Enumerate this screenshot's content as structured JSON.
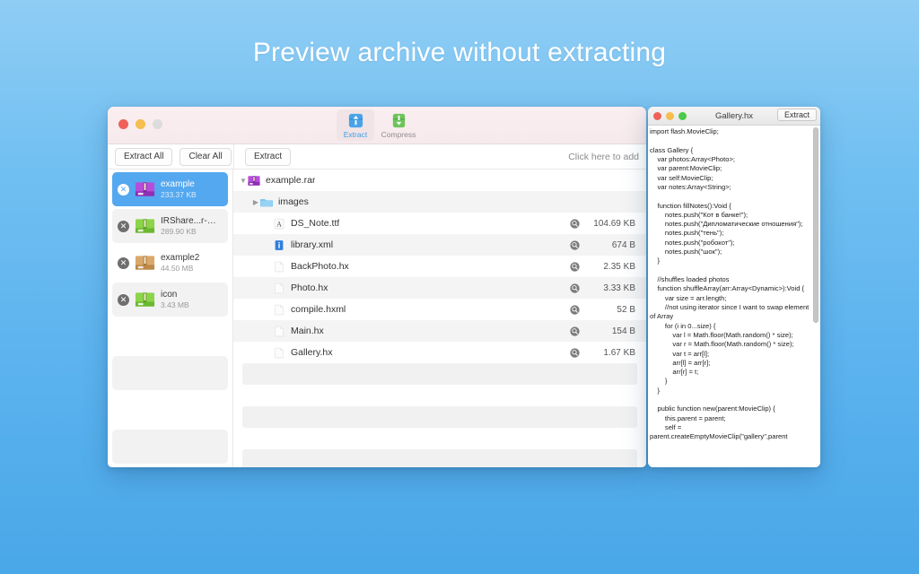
{
  "headline": "Preview archive without extracting",
  "main_window": {
    "traffic_lights": [
      "close",
      "minimize",
      "zoom-disabled"
    ],
    "toolbar": {
      "items": [
        {
          "label": "Extract",
          "icon": "extract-icon",
          "active": true
        },
        {
          "label": "Compress",
          "icon": "compress-icon",
          "active": false
        }
      ]
    },
    "subbar": {
      "extract_all_label": "Extract All",
      "clear_all_label": "Clear All",
      "extract_label": "Extract",
      "add_hint": "Click here to add"
    },
    "sidebar": {
      "items": [
        {
          "name": "example",
          "size": "233.37 KB",
          "type": "rar",
          "selected": true
        },
        {
          "name": "IRShare...r-master",
          "size": "289.90 KB",
          "type": "zip",
          "selected": false
        },
        {
          "name": "example2",
          "size": "44.50 MB",
          "type": "tar",
          "selected": false
        },
        {
          "name": "icon",
          "size": "3.43 MB",
          "type": "zip",
          "selected": false
        }
      ]
    },
    "filelist": {
      "rows": [
        {
          "name": "example.rar",
          "size": "",
          "icon": "rar-archive-icon",
          "indent": 0,
          "disclosure": "down",
          "shade": false,
          "magnifier": false
        },
        {
          "name": "images",
          "size": "",
          "icon": "folder-icon",
          "indent": 1,
          "disclosure": "right",
          "shade": true,
          "magnifier": false
        },
        {
          "name": "DS_Note.ttf",
          "size": "104.69 KB",
          "icon": "font-file-icon",
          "indent": 2,
          "disclosure": "",
          "shade": false,
          "magnifier": true
        },
        {
          "name": "library.xml",
          "size": "674 B",
          "icon": "xml-file-icon",
          "indent": 2,
          "disclosure": "",
          "shade": true,
          "magnifier": true
        },
        {
          "name": "BackPhoto.hx",
          "size": "2.35 KB",
          "icon": "text-file-icon",
          "indent": 2,
          "disclosure": "",
          "shade": false,
          "magnifier": true
        },
        {
          "name": "Photo.hx",
          "size": "3.33 KB",
          "icon": "text-file-icon",
          "indent": 2,
          "disclosure": "",
          "shade": true,
          "magnifier": true
        },
        {
          "name": "compile.hxml",
          "size": "52 B",
          "icon": "text-file-icon",
          "indent": 2,
          "disclosure": "",
          "shade": false,
          "magnifier": true
        },
        {
          "name": "Main.hx",
          "size": "154 B",
          "icon": "text-file-icon",
          "indent": 2,
          "disclosure": "",
          "shade": true,
          "magnifier": true
        },
        {
          "name": "Gallery.hx",
          "size": "1.67 KB",
          "icon": "text-file-icon",
          "indent": 2,
          "disclosure": "",
          "shade": false,
          "magnifier": true
        }
      ]
    }
  },
  "preview_window": {
    "title": "Gallery.hx",
    "extract_label": "Extract",
    "traffic_lights": [
      "close",
      "minimize",
      "zoom"
    ],
    "code": "import flash.MovieClip;\n\nclass Gallery {\n    var photos:Array<Photo>;\n    var parent:MovieClip;\n    var self:MovieClip;\n    var notes:Array<String>;\n\n    function fillNotes():Void {\n        notes.push(\"Кот в банке!\");\n        notes.push(\"Дипломатические отношения\");\n        notes.push(\"тень\");\n        notes.push(\"робокот\");\n        notes.push(\"шок\");\n    }\n\n    //shuffles loaded photos\n    function shuffleArray(arr:Array<Dynamic>):Void {\n        var size = arr.length;\n        //not using iterator since I want to swap element of Array\n        for (i in 0...size) {\n            var l = Math.floor(Math.random() * size);\n            var r = Math.floor(Math.random() * size);\n            var t = arr[l];\n            arr[l] = arr[r];\n            arr[r] = t;\n        }\n    }\n\n    public function new(parent:MovieClip) {\n        this.parent = parent;\n        self = parent.createEmptyMovieClip(\"gallery\",parent"
  },
  "colors": {
    "background_top": "#8fcdf4",
    "background_bottom": "#4aa7e8",
    "accent_blue": "#54a8ef",
    "extract_blue": "#3d9de8",
    "compress_green": "#6ec45a"
  }
}
